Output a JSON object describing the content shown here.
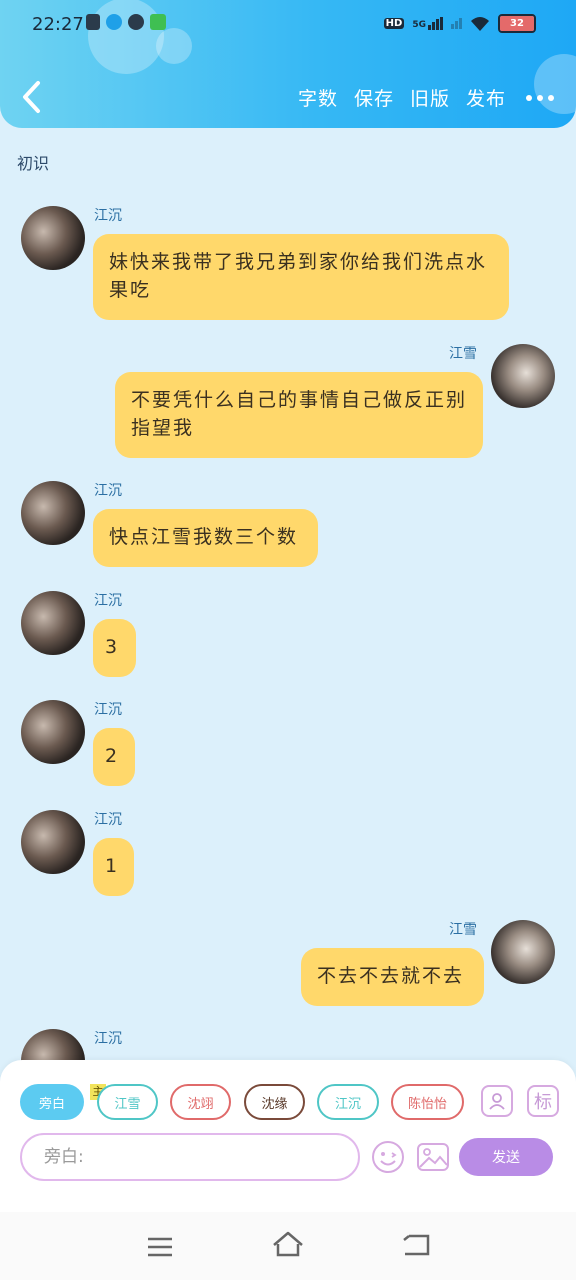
{
  "status": {
    "time": "22:27",
    "net": "5G",
    "hd": "HD",
    "battery": "32"
  },
  "nav": {
    "actions": [
      "字数",
      "保存",
      "旧版",
      "发布"
    ]
  },
  "chat": {
    "title": "初识",
    "messages": [
      {
        "sender": "江沉",
        "text": "妹快来我带了我兄弟到家你给我们洗点水果吃",
        "side": "left"
      },
      {
        "sender": "江雪",
        "text": "不要凭什么自己的事情自己做反正别指望我",
        "side": "right"
      },
      {
        "sender": "江沉",
        "text": "快点江雪我数三个数",
        "side": "left"
      },
      {
        "sender": "江沉",
        "text": "3",
        "side": "left"
      },
      {
        "sender": "江沉",
        "text": "2",
        "side": "left"
      },
      {
        "sender": "江沉",
        "text": "1",
        "side": "left"
      },
      {
        "sender": "江雪",
        "text": "不去不去就不去",
        "side": "right"
      },
      {
        "sender": "江沉",
        "text": "",
        "side": "left"
      }
    ]
  },
  "composer": {
    "chips": [
      {
        "label": "旁白",
        "color": "#5ccbf1"
      },
      {
        "label": "江雪",
        "color": "#4fc6c6"
      },
      {
        "label": "沈翊",
        "color": "#e06a6a"
      },
      {
        "label": "沈缘",
        "color": "#7a4a3a"
      },
      {
        "label": "江沉",
        "color": "#4fc6c6"
      },
      {
        "label": "陈怡怡",
        "color": "#e06a6a"
      }
    ],
    "main_badge": "主",
    "mark_label": "标",
    "input_placeholder": "旁白:",
    "send_label": "发送"
  }
}
